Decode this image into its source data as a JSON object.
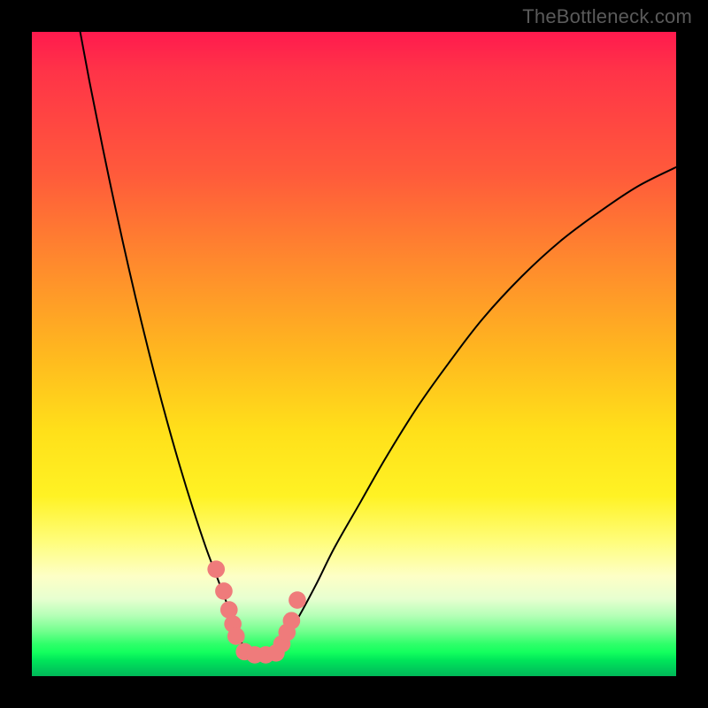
{
  "watermark_text": "TheBottleneck.com",
  "chart_data": {
    "type": "line",
    "title": "",
    "xlabel": "",
    "ylabel": "",
    "xlim": [
      0,
      100
    ],
    "ylim": [
      0,
      100
    ],
    "gradient_stops": [
      {
        "pos": 0,
        "color": "#ff1a4e"
      },
      {
        "pos": 6,
        "color": "#ff3348"
      },
      {
        "pos": 22,
        "color": "#ff5a3b"
      },
      {
        "pos": 36,
        "color": "#ff8a2d"
      },
      {
        "pos": 50,
        "color": "#ffb81f"
      },
      {
        "pos": 62,
        "color": "#ffe01a"
      },
      {
        "pos": 72,
        "color": "#fff224"
      },
      {
        "pos": 79,
        "color": "#fffd7a"
      },
      {
        "pos": 84.5,
        "color": "#fdffc6"
      },
      {
        "pos": 88,
        "color": "#e7ffd0"
      },
      {
        "pos": 90.5,
        "color": "#b7ffb8"
      },
      {
        "pos": 93,
        "color": "#73ff8e"
      },
      {
        "pos": 95,
        "color": "#2fff6a"
      },
      {
        "pos": 96.3,
        "color": "#13ff5e"
      },
      {
        "pos": 97.5,
        "color": "#00e65a"
      },
      {
        "pos": 99,
        "color": "#00c95a"
      },
      {
        "pos": 100,
        "color": "#00b858"
      }
    ],
    "series": [
      {
        "name": "left-curve",
        "color": "#000000",
        "x": [
          7.5,
          9.0,
          11.0,
          13.0,
          15.0,
          17.0,
          19.0,
          21.0,
          23.0,
          25.0,
          27.0,
          28.5,
          30.0,
          31.5,
          33.0
        ],
        "y": [
          100.0,
          92.0,
          82.0,
          72.5,
          63.5,
          55.0,
          47.0,
          39.5,
          32.5,
          26.0,
          20.0,
          16.0,
          12.0,
          8.0,
          4.0
        ]
      },
      {
        "name": "right-curve",
        "color": "#000000",
        "x": [
          38.0,
          41.0,
          44.0,
          47.0,
          51.0,
          55.0,
          60.0,
          65.0,
          70.0,
          76.0,
          82.0,
          88.0,
          94.0,
          100.0
        ],
        "y": [
          4.0,
          8.5,
          14.0,
          20.0,
          27.0,
          34.0,
          42.0,
          49.0,
          55.5,
          62.0,
          67.5,
          72.0,
          76.0,
          79.0
        ]
      },
      {
        "name": "valley-floor",
        "color": "#000000",
        "x": [
          33.0,
          35.5,
          38.0
        ],
        "y": [
          4.0,
          3.2,
          4.0
        ]
      }
    ],
    "marker_points": {
      "name": "salmon-dots",
      "color": "#ef7b7b",
      "radius_pct": 1.35,
      "points": [
        {
          "x": 28.6,
          "y": 16.6
        },
        {
          "x": 29.8,
          "y": 13.2
        },
        {
          "x": 30.6,
          "y": 10.3
        },
        {
          "x": 31.2,
          "y": 8.1
        },
        {
          "x": 31.7,
          "y": 6.2
        },
        {
          "x": 33.0,
          "y": 3.8
        },
        {
          "x": 34.6,
          "y": 3.3
        },
        {
          "x": 36.3,
          "y": 3.3
        },
        {
          "x": 37.9,
          "y": 3.6
        },
        {
          "x": 38.8,
          "y": 5.0
        },
        {
          "x": 39.6,
          "y": 6.8
        },
        {
          "x": 40.3,
          "y": 8.6
        },
        {
          "x": 41.2,
          "y": 11.8
        }
      ]
    }
  }
}
